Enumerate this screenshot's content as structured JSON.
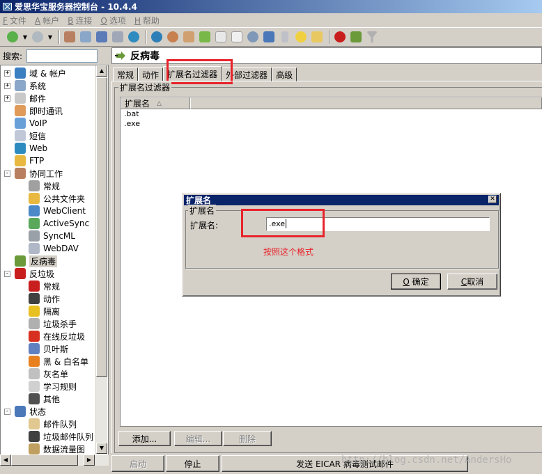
{
  "window": {
    "title": "爱思华宝服务器控制台 - 10.4.4"
  },
  "menu": [
    {
      "key": "F",
      "label": "文件"
    },
    {
      "key": "A",
      "label": "帐户"
    },
    {
      "key": "B",
      "label": "连接"
    },
    {
      "key": "O",
      "label": "选项"
    },
    {
      "key": "H",
      "label": "帮助"
    }
  ],
  "search": {
    "label": "搜索:",
    "value": ""
  },
  "tree": [
    {
      "label": "域 & 帐户",
      "icon": "globe-user-icon",
      "color": "#3a7fc0",
      "level": 0,
      "expander": "+"
    },
    {
      "label": "系统",
      "icon": "system-icon",
      "color": "#8aa6c8",
      "level": 0,
      "expander": "+"
    },
    {
      "label": "邮件",
      "icon": "mail-icon",
      "color": "#c8c8c8",
      "level": 0,
      "expander": "+"
    },
    {
      "label": "即时通讯",
      "icon": "im-icon",
      "color": "#e09a5a",
      "level": 0,
      "expander": ""
    },
    {
      "label": "VoIP",
      "icon": "headset-icon",
      "color": "#6aa0d8",
      "level": 0,
      "expander": ""
    },
    {
      "label": "短信",
      "icon": "sms-icon",
      "color": "#c0c8d8",
      "level": 0,
      "expander": ""
    },
    {
      "label": "Web",
      "icon": "web-globe-icon",
      "color": "#2e8bc0",
      "level": 0,
      "expander": ""
    },
    {
      "label": "FTP",
      "icon": "ftp-folder-icon",
      "color": "#e8b840",
      "level": 0,
      "expander": ""
    },
    {
      "label": "协同工作",
      "icon": "groupware-icon",
      "color": "#b88060",
      "level": 0,
      "expander": "-"
    },
    {
      "label": "常规",
      "icon": "tools-icon",
      "color": "#a0a0a0",
      "level": 1,
      "expander": ""
    },
    {
      "label": "公共文件夹",
      "icon": "public-folder-icon",
      "color": "#e8b840",
      "level": 1,
      "expander": ""
    },
    {
      "label": "WebClient",
      "icon": "webclient-icon",
      "color": "#4a88c8",
      "level": 1,
      "expander": ""
    },
    {
      "label": "ActiveSync",
      "icon": "activesync-icon",
      "color": "#5aa85a",
      "level": 1,
      "expander": ""
    },
    {
      "label": "SyncML",
      "icon": "syncml-icon",
      "color": "#9aa0a8",
      "level": 1,
      "expander": ""
    },
    {
      "label": "WebDAV",
      "icon": "webdav-icon",
      "color": "#b0b8c8",
      "level": 1,
      "expander": ""
    },
    {
      "label": "反病毒",
      "icon": "antivirus-icon",
      "color": "#6a9a3a",
      "level": 0,
      "expander": "",
      "selected": true
    },
    {
      "label": "反垃圾",
      "icon": "no-entry-icon",
      "color": "#c81e1e",
      "level": 0,
      "expander": "-"
    },
    {
      "label": "常规",
      "icon": "no-entry-icon",
      "color": "#c81e1e",
      "level": 1,
      "expander": ""
    },
    {
      "label": "动作",
      "icon": "traffic-light-icon",
      "color": "#404040",
      "level": 1,
      "expander": ""
    },
    {
      "label": "隔离",
      "icon": "biohazard-icon",
      "color": "#e8c020",
      "level": 1,
      "expander": ""
    },
    {
      "label": "垃圾杀手",
      "icon": "spam-killer-icon",
      "color": "#b0b0b0",
      "level": 1,
      "expander": ""
    },
    {
      "label": "在线反垃圾",
      "icon": "online-antispam-icon",
      "color": "#d83020",
      "level": 1,
      "expander": ""
    },
    {
      "label": "贝叶斯",
      "icon": "magnifier-icon",
      "color": "#6080c0",
      "level": 1,
      "expander": ""
    },
    {
      "label": "黑 & 白名单",
      "icon": "cone-icon",
      "color": "#e88020",
      "level": 1,
      "expander": ""
    },
    {
      "label": "灰名单",
      "icon": "greylist-mail-icon",
      "color": "#c0c0c0",
      "level": 1,
      "expander": ""
    },
    {
      "label": "学习规则",
      "icon": "rules-icon",
      "color": "#d0d0d0",
      "level": 1,
      "expander": ""
    },
    {
      "label": "其他",
      "icon": "puzzle-icon",
      "color": "#505050",
      "level": 1,
      "expander": ""
    },
    {
      "label": "状态",
      "icon": "monitor-icon",
      "color": "#4a78b8",
      "level": 0,
      "expander": "-"
    },
    {
      "label": "邮件队列",
      "icon": "mail-queue-icon",
      "color": "#e0c890",
      "level": 1,
      "expander": ""
    },
    {
      "label": "垃圾邮件队列",
      "icon": "traffic-light-icon",
      "color": "#404040",
      "level": 1,
      "expander": ""
    },
    {
      "label": "数据流量图",
      "icon": "chart-icon",
      "color": "#c0a060",
      "level": 1,
      "expander": ""
    }
  ],
  "panel": {
    "title": "反病毒"
  },
  "tabs": [
    "常规",
    "动作",
    "扩展名过滤器",
    "外部过滤器",
    "高级"
  ],
  "active_tab": 2,
  "group": {
    "label": "扩展名过滤器"
  },
  "list": {
    "column": "扩展名",
    "sort_glyph": "△",
    "rows": [
      ".bat",
      ".exe"
    ]
  },
  "buttons": {
    "add": "添加...",
    "edit": "编辑...",
    "delete": "删除"
  },
  "footer": {
    "start": "启动",
    "stop": "停止",
    "eicar": "发送 EICAR 病毒测试邮件"
  },
  "dialog": {
    "title": "扩展名",
    "group_label": "扩展名",
    "field_label": "扩展名:",
    "field_value": ".exe",
    "ok": "确定",
    "ok_key": "O",
    "cancel": "取消",
    "cancel_key": "C"
  },
  "annotation": {
    "hint": "按照这个格式",
    "color": "#e8232a"
  },
  "watermark": "http://blog.csdn.net/AndersHo"
}
